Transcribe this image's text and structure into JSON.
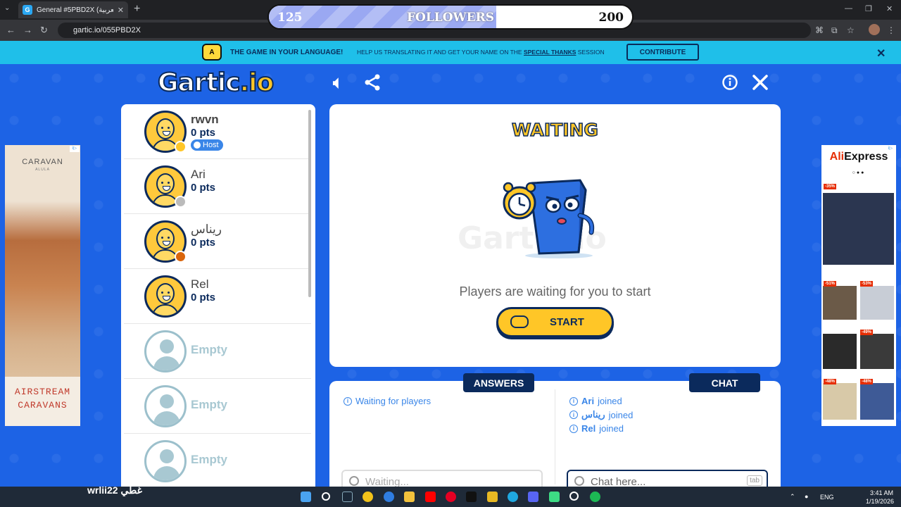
{
  "browser": {
    "tab_title": "General #5PBD2X (العربية) -",
    "tab_favicon": "G",
    "url": "gartic.io/055PBD2X",
    "new_tab": "+",
    "tab_list": "⌄",
    "close_tab": "✕"
  },
  "followers": {
    "current": "125",
    "label": "FOLLOWERS",
    "goal": "200",
    "fill_fraction": 0.625
  },
  "banner": {
    "icon": "A",
    "title": "THE GAME IN YOUR LANGUAGE!",
    "text_before": "HELP US TRANSLATING IT AND GET YOUR NAME ON THE ",
    "text_link": "SPECIAL THANKS",
    "text_after": " SESSION",
    "button": "CONTRIBUTE"
  },
  "logo": {
    "main": "Gartic",
    "suffix": ".io"
  },
  "players": [
    {
      "name": "rwvn",
      "points": "0 pts",
      "badge": "Host",
      "dot_color": "#ffc627"
    },
    {
      "name": "Ari",
      "points": "0 pts",
      "badge": "",
      "dot_color": "#bbbbbb"
    },
    {
      "name": "ريناس",
      "points": "0 pts",
      "badge": "",
      "dot_color": "#d9650b"
    },
    {
      "name": "Rel",
      "points": "0 pts",
      "badge": "",
      "dot_color": ""
    }
  ],
  "empty_slot_label": "Empty",
  "main": {
    "status_title": "WAITING",
    "watermark": "Gartic.io",
    "message": "Players are waiting for you to start",
    "start_button": "START"
  },
  "answers": {
    "tab": "ANSWERS",
    "messages": [
      {
        "text": "Waiting for players"
      }
    ],
    "input_placeholder": "Waiting..."
  },
  "chat": {
    "tab": "CHAT",
    "messages": [
      {
        "user": "Ari",
        "text": "joined"
      },
      {
        "user": "ريناس",
        "text": "joined"
      },
      {
        "user": "Rel",
        "text": "joined"
      }
    ],
    "input_placeholder": "Chat here...",
    "tab_key": "tab"
  },
  "ads": {
    "left": {
      "brand": "CARAVAN",
      "sub": "ALULA",
      "headline_1": "AIRSTREAM",
      "headline_2": "CARAVANS"
    },
    "right": {
      "brand_a": "Ali",
      "brand_b": "Express",
      "dots": "○●●",
      "discounts": [
        "-35%",
        "-51%",
        "-53%",
        "-49%",
        "-48%",
        "-48%"
      ]
    }
  },
  "desktop": {
    "overlay_text": "wrlii22 غطي"
  },
  "taskbar": {
    "lang": "ENG",
    "time": "3:41 AM",
    "date": "1/19/2026"
  },
  "colors": {
    "background": "#1d63e5",
    "accent_yellow": "#ffc627",
    "navy": "#0b2a5c",
    "link_blue": "#3a86e8",
    "banner": "#1fbfe9"
  }
}
